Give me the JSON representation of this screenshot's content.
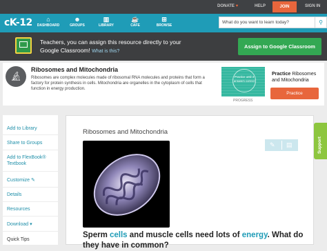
{
  "topbar": {
    "donate": "DONATE",
    "donate_icon": "heart-icon",
    "help": "HELP",
    "join": "JOIN",
    "signin": "SIGN IN"
  },
  "navbar": {
    "logo": "cK-12",
    "items": [
      {
        "label": "DASHBOARD",
        "icon": "home-icon"
      },
      {
        "label": "GROUPS",
        "icon": "group-icon"
      },
      {
        "label": "LIBRARY",
        "icon": "library-icon"
      },
      {
        "label": "CAFE",
        "icon": "cafe-icon"
      },
      {
        "label": "BROWSE",
        "icon": "browse-icon"
      }
    ],
    "search_placeholder": "What do you want to learn today?",
    "search_icon": "search-icon"
  },
  "classroom": {
    "text": "Teachers, you can assign this resource directly to your Google Classroom!",
    "what_link": "What is this?",
    "button": "Assign to Google Classroom",
    "icon": "google-classroom-icon"
  },
  "concept": {
    "icon": "microscope-icon",
    "title": "Ribosomes and Mitochondria",
    "description": "Ribosomes are complex molecules made of ribosomal RNA molecules and proteins that form a factory for protein synthesis in cells. Mitochondria are organelles in the cytoplasm of cells that function in energy production."
  },
  "practice": {
    "badge_text": "Practice until 3 answers correct",
    "progress_label": "PROGRESS",
    "title_prefix": "Practice",
    "title": "Ribosomes and Mitochondria",
    "button": "Practice"
  },
  "sidebar": {
    "items": [
      {
        "label": "Add to Library"
      },
      {
        "label": "Share to Groups"
      },
      {
        "label": "Add to FlexBook® Textbook"
      },
      {
        "label": "Customize"
      },
      {
        "label": "Details"
      },
      {
        "label": "Resources"
      },
      {
        "label": "Download"
      },
      {
        "label": "Quick Tips"
      }
    ]
  },
  "content": {
    "title": "Ribosomes and Mitochondria",
    "image_subject": "mitochondrion-illustration",
    "edit_icon": "pencil-icon",
    "notes_icon": "notes-icon",
    "sentence_parts": [
      "Sperm ",
      "cells",
      " and muscle cells need lots of ",
      "energy",
      ". What do they have in common?"
    ]
  },
  "support": {
    "label": "Support"
  }
}
